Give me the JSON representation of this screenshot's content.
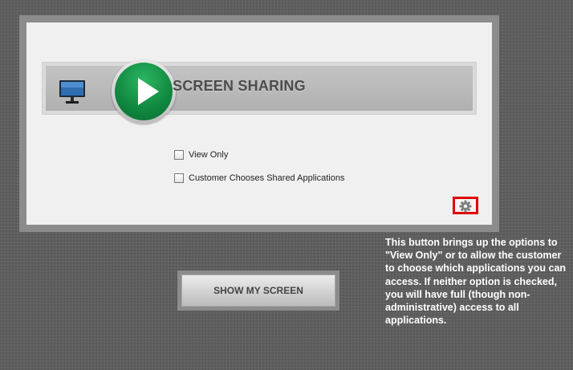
{
  "header": {
    "title": "SCREEN SHARING"
  },
  "options": [
    {
      "label": "View Only",
      "checked": false
    },
    {
      "label": "Customer Chooses Shared Applications",
      "checked": false
    }
  ],
  "icons": {
    "monitor": "monitor-icon",
    "play": "play-icon",
    "settings": "gear-icon"
  },
  "buttons": {
    "show_screen_label": "SHOW MY SCREEN"
  },
  "annotation": {
    "text": "This button brings up the options to \"View Only\" or to allow the customer to choose which applications you can access. If neither option is checked, you will have full (though non-administrative) access to all applications."
  },
  "colors": {
    "play_green": "#10873f",
    "highlight_red": "#e00000",
    "background": "#5f5f5f"
  }
}
